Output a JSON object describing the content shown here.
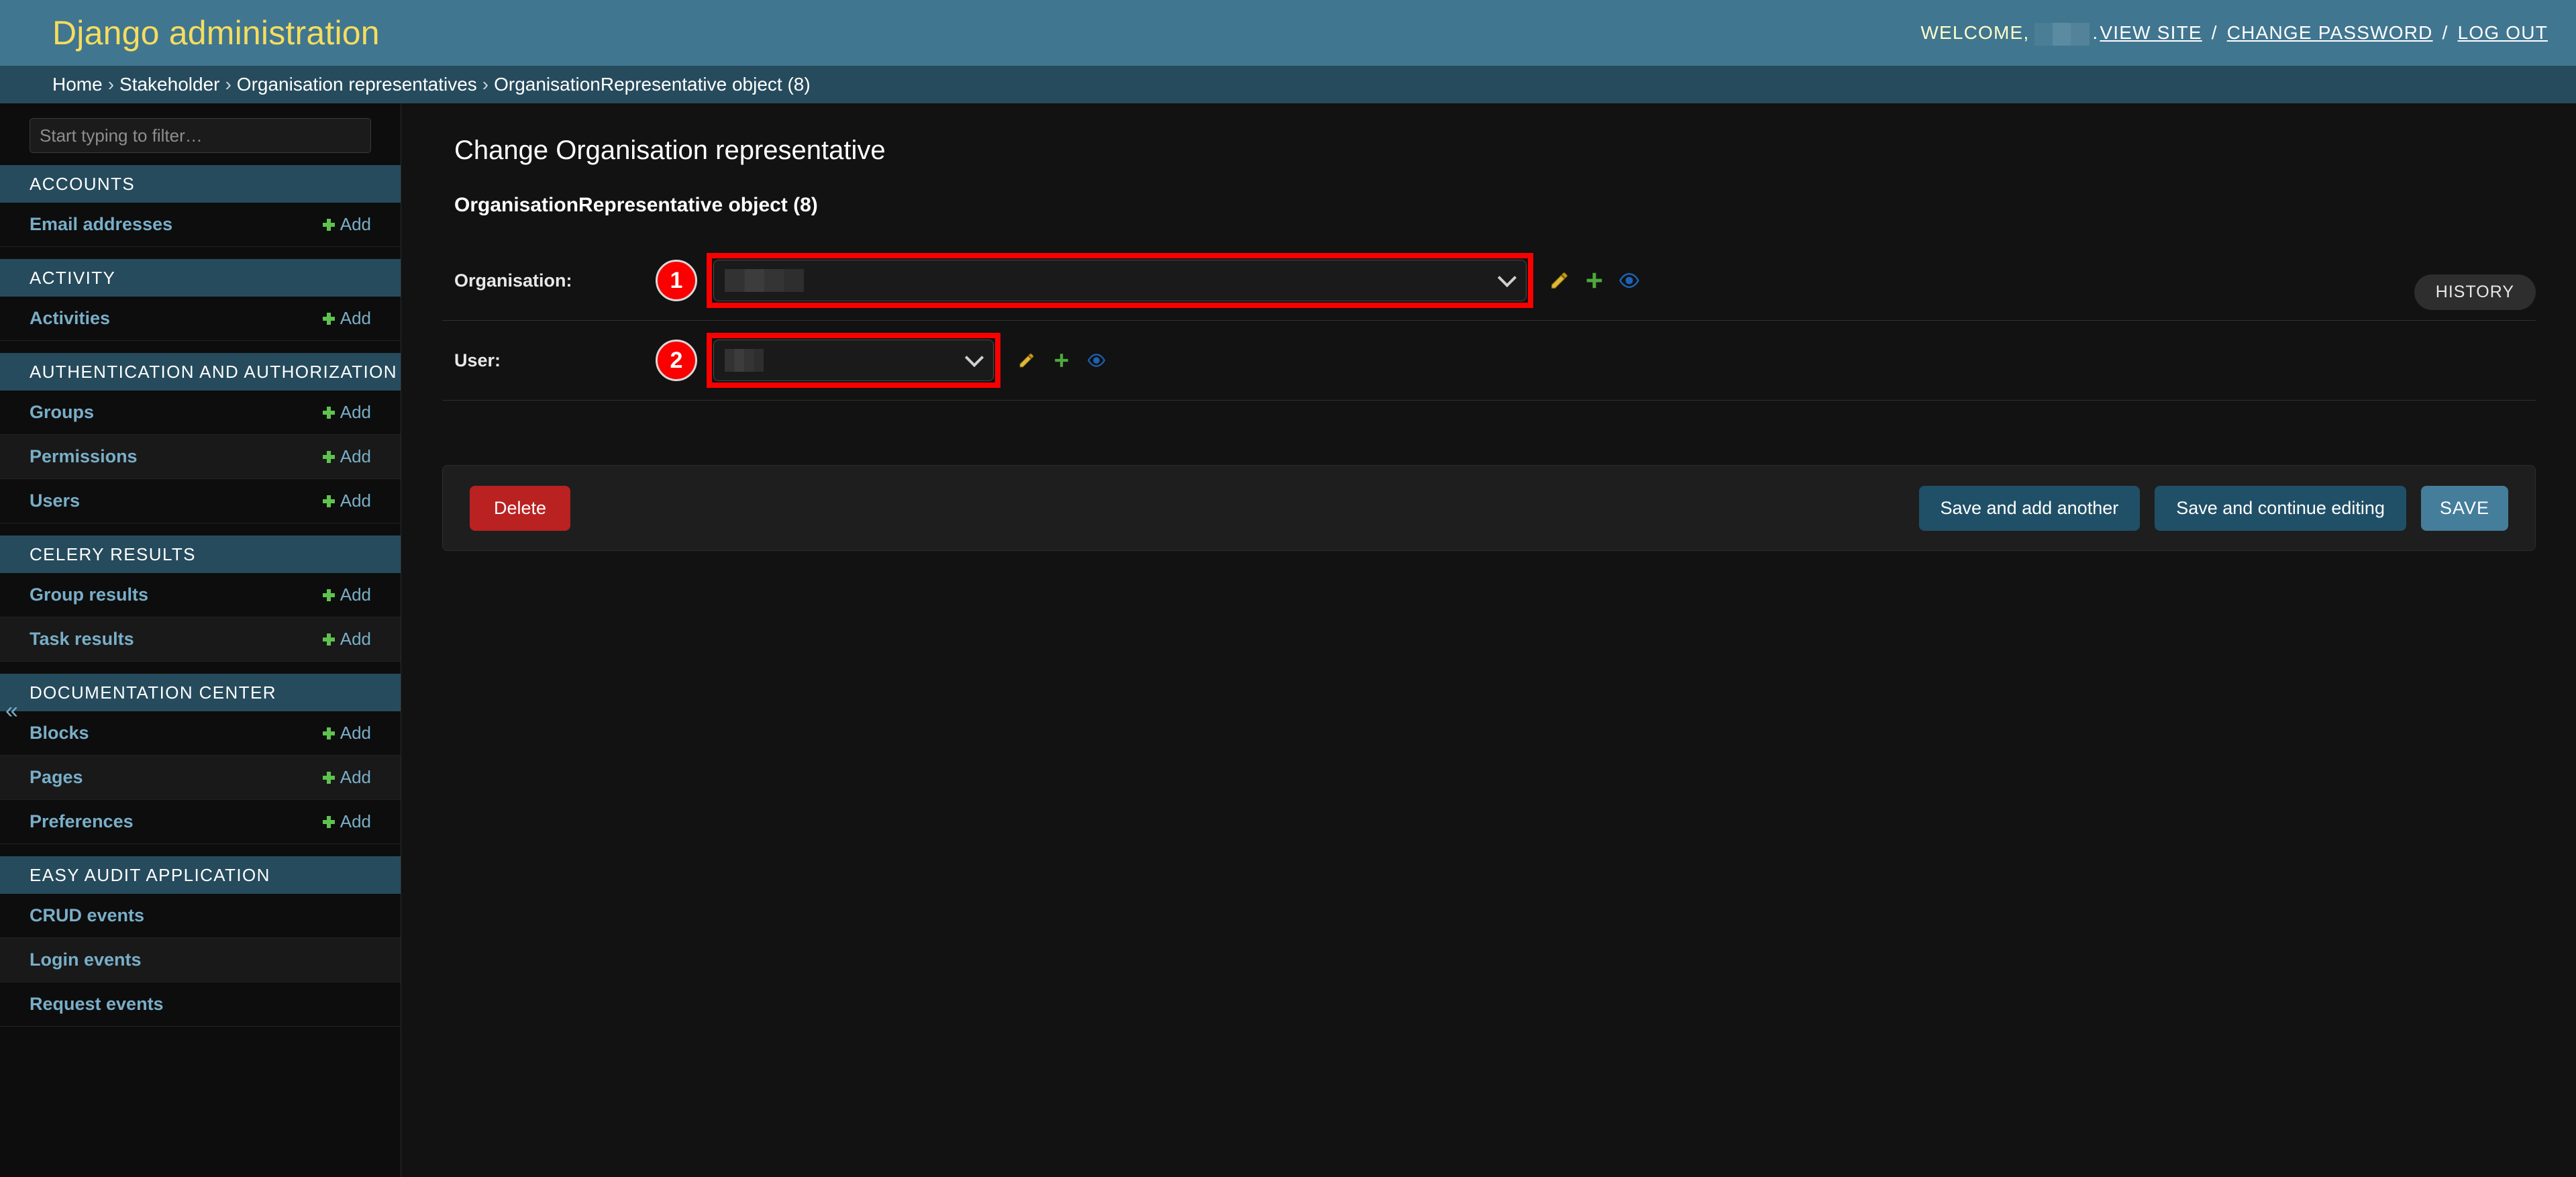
{
  "header": {
    "brand": "Django administration",
    "welcome_label": "WELCOME,",
    "welcome_suffix": ".",
    "links": [
      {
        "label": "VIEW SITE"
      },
      {
        "label": "CHANGE PASSWORD"
      },
      {
        "label": "LOG OUT"
      }
    ],
    "separator": "/"
  },
  "breadcrumbs": {
    "items": [
      {
        "label": "Home"
      },
      {
        "label": "Stakeholder"
      },
      {
        "label": "Organisation representatives"
      },
      {
        "label": "OrganisationRepresentative object (8)"
      }
    ],
    "separator": "›"
  },
  "sidebar": {
    "filter_placeholder": "Start typing to filter…",
    "filter_value": "",
    "collapse_glyph": "«",
    "add_label": "Add",
    "modules": [
      {
        "caption": "ACCOUNTS",
        "rows": [
          {
            "label": "Email addresses",
            "has_add": true
          }
        ]
      },
      {
        "caption": "ACTIVITY",
        "rows": [
          {
            "label": "Activities",
            "has_add": true
          }
        ]
      },
      {
        "caption": "AUTHENTICATION AND AUTHORIZATION",
        "rows": [
          {
            "label": "Groups",
            "has_add": true
          },
          {
            "label": "Permissions",
            "has_add": true
          },
          {
            "label": "Users",
            "has_add": true
          }
        ]
      },
      {
        "caption": "CELERY RESULTS",
        "rows": [
          {
            "label": "Group results",
            "has_add": true
          },
          {
            "label": "Task results",
            "has_add": true
          }
        ]
      },
      {
        "caption": "DOCUMENTATION CENTER",
        "rows": [
          {
            "label": "Blocks",
            "has_add": true
          },
          {
            "label": "Pages",
            "has_add": true
          },
          {
            "label": "Preferences",
            "has_add": true
          }
        ]
      },
      {
        "caption": "EASY AUDIT APPLICATION",
        "rows": [
          {
            "label": "CRUD events",
            "has_add": false
          },
          {
            "label": "Login events",
            "has_add": false
          },
          {
            "label": "Request events",
            "has_add": false
          }
        ]
      }
    ]
  },
  "main": {
    "page_title": "Change Organisation representative",
    "history_label": "HISTORY",
    "object_title": "OrganisationRepresentative object (8)",
    "form_rows": [
      {
        "label": "Organisation:",
        "step": "1",
        "value": "",
        "value_redacted": true,
        "icons": [
          {
            "name": "edit-pencil-icon",
            "title": "Change"
          },
          {
            "name": "add-plus-icon",
            "title": "Add another"
          },
          {
            "name": "view-eye-icon",
            "title": "View"
          }
        ]
      },
      {
        "label": "User:",
        "step": "2",
        "value": "",
        "value_redacted": true,
        "icons": [
          {
            "name": "edit-pencil-icon",
            "title": "Change"
          },
          {
            "name": "add-plus-icon",
            "title": "Add another"
          },
          {
            "name": "view-eye-icon",
            "title": "View"
          }
        ]
      }
    ],
    "submit_row": {
      "delete_label": "Delete",
      "save_add_another_label": "Save and add another",
      "save_continue_label": "Save and continue editing",
      "save_label": "SAVE"
    }
  },
  "colors": {
    "header_blue": "#417690",
    "breadcrumb_blue": "#264b5d",
    "brand_yellow": "#f5dd5d",
    "link_blue": "#79aec8",
    "add_green": "#5fc24f",
    "delete_red": "#ba2121",
    "save_blue": "#447e9b",
    "save_alt_blue": "#205067",
    "highlight_red": "#fb0000",
    "page_bg": "#121212",
    "sidebar_bg": "#0d0d0d",
    "pencil_gold": "#d4a017",
    "eye_blue": "#1d63b5"
  }
}
